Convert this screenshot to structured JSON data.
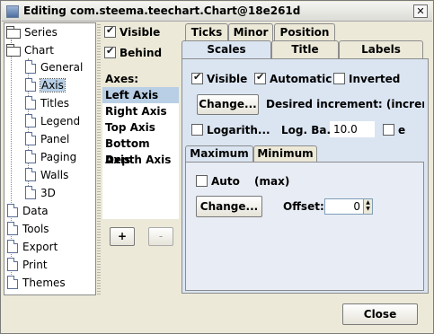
{
  "window": {
    "title": "Editing com.steema.teechart.Chart@18e261d",
    "close_glyph": "✕"
  },
  "tree": {
    "items": [
      {
        "label": "Series",
        "icon": "folder-icon"
      },
      {
        "label": "Chart",
        "icon": "folder-icon"
      },
      {
        "label": "General",
        "icon": "document-icon"
      },
      {
        "label": "Axis",
        "icon": "document-icon",
        "selected": true
      },
      {
        "label": "Titles",
        "icon": "document-icon"
      },
      {
        "label": "Legend",
        "icon": "document-icon"
      },
      {
        "label": "Panel",
        "icon": "document-icon"
      },
      {
        "label": "Paging",
        "icon": "document-icon"
      },
      {
        "label": "Walls",
        "icon": "document-icon"
      },
      {
        "label": "3D",
        "icon": "document-icon"
      },
      {
        "label": "Data",
        "icon": "document-icon"
      },
      {
        "label": "Tools",
        "icon": "document-icon"
      },
      {
        "label": "Export",
        "icon": "document-icon"
      },
      {
        "label": "Print",
        "icon": "document-icon"
      },
      {
        "label": "Themes",
        "icon": "document-icon"
      }
    ]
  },
  "axis_options": {
    "visible_label": "Visible",
    "visible_checked": true,
    "behind_label": "Behind",
    "behind_checked": true
  },
  "axes_list": {
    "label": "Axes:",
    "items": [
      "Left Axis",
      "Right Axis",
      "Top Axis",
      "Bottom Axis",
      "Depth Axis"
    ],
    "selected": "Left Axis",
    "add_label": "+",
    "remove_label": "-"
  },
  "tabs": {
    "row1": [
      "Ticks",
      "Minor",
      "Position"
    ],
    "row2": [
      "Scales",
      "Title",
      "Labels"
    ],
    "active": "Scales"
  },
  "scales": {
    "visible_label": "Visible",
    "visible_checked": true,
    "automatic_label": "Automatic",
    "automatic_checked": true,
    "inverted_label": "Inverted",
    "inverted_checked": false,
    "change_label": "Change...",
    "desired_increment_label": "Desired increment: (increme...",
    "logarithmic_label": "Logarith...",
    "logarithmic_checked": false,
    "log_base_label": "Log. Ba...",
    "log_base_value": "10.0",
    "e_label": "e",
    "e_checked": false
  },
  "subtabs": {
    "items": [
      "Maximum",
      "Minimum"
    ],
    "active": "Maximum"
  },
  "maximum": {
    "auto_label": "Auto",
    "auto_checked": false,
    "max_label": "(max)",
    "change_label": "Change...",
    "offset_label": "Offset:",
    "offset_value": "0"
  },
  "footer": {
    "close_label": "Close"
  }
}
